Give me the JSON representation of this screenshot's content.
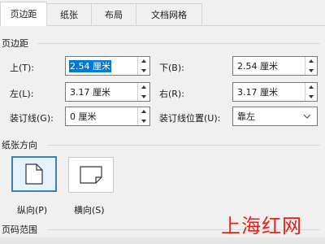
{
  "tabs": [
    {
      "label": "页边距",
      "active": true
    },
    {
      "label": "纸张",
      "active": false
    },
    {
      "label": "布局",
      "active": false
    },
    {
      "label": "文档网格",
      "active": false
    }
  ],
  "margins": {
    "section_title": "页边距",
    "top_label": "上(T):",
    "top_value": "2.54 厘米",
    "bottom_label": "下(B):",
    "bottom_value": "2.54 厘米",
    "left_label": "左(L):",
    "left_value": "3.17 厘米",
    "right_label": "右(R):",
    "right_value": "3.17 厘米",
    "gutter_label": "装订线(G):",
    "gutter_value": "0 厘米",
    "gutter_pos_label": "装订线位置(U):",
    "gutter_pos_value": "靠左"
  },
  "orientation": {
    "section_title": "纸张方向",
    "portrait_label": "纵向(P)",
    "landscape_label": "横向(S)",
    "selected": "portrait"
  },
  "pages": {
    "section_title": "页码范围"
  },
  "watermark": "上海红网",
  "colors": {
    "selection": "#0078d7",
    "watermark": "#e42218",
    "selected_border": "#3c7fb1"
  }
}
